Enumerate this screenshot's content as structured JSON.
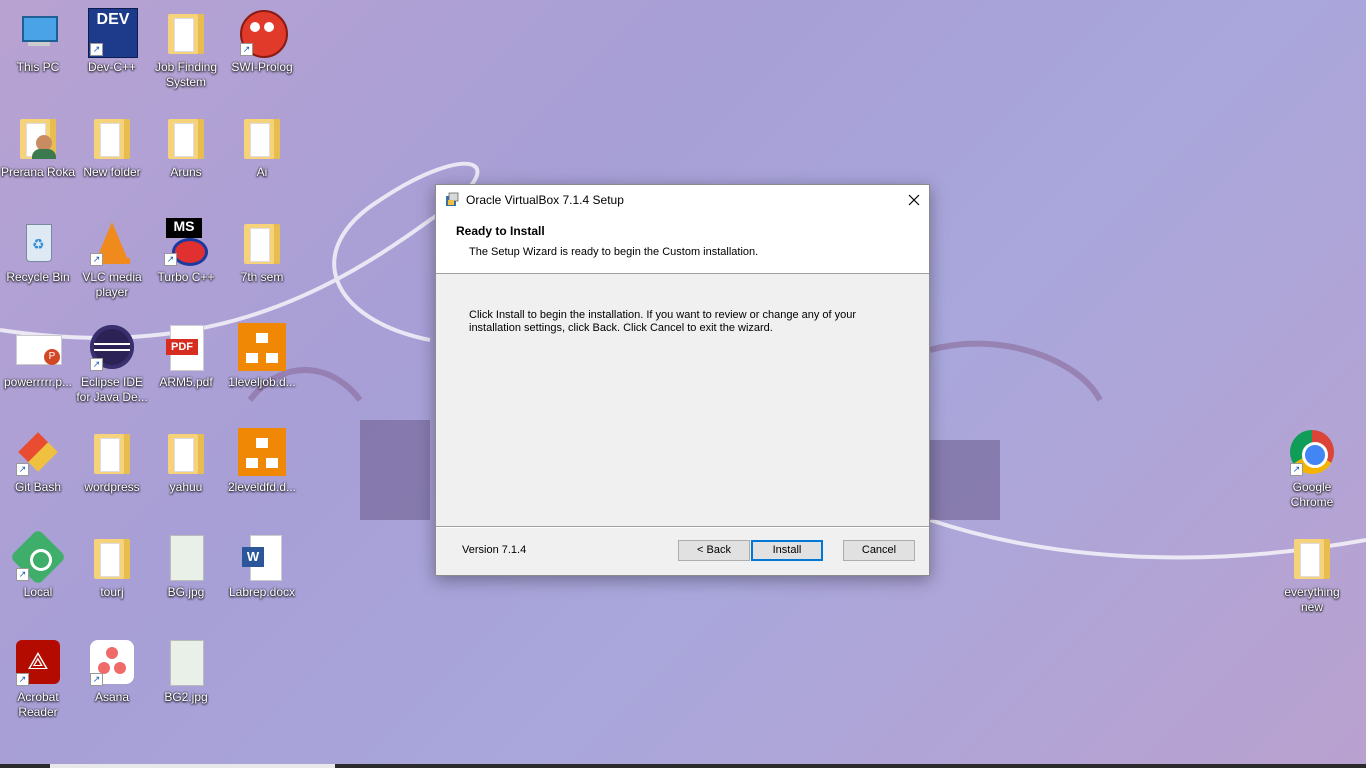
{
  "desktop": {
    "icons": [
      {
        "label": "This PC",
        "icon": "this-pc-icon",
        "shortcut": false
      },
      {
        "label": "Dev-C++",
        "icon": "dev-cpp-icon",
        "shortcut": true
      },
      {
        "label": "Job Finding System",
        "icon": "folder-icon",
        "shortcut": false
      },
      {
        "label": "SWI-Prolog",
        "icon": "swi-prolog-icon",
        "shortcut": true
      },
      {
        "label": "Prerana Roka",
        "icon": "user-folder-icon",
        "shortcut": false
      },
      {
        "label": "New folder",
        "icon": "folder-icon",
        "shortcut": false
      },
      {
        "label": "Aruns",
        "icon": "folder-icon",
        "shortcut": false
      },
      {
        "label": "Ai",
        "icon": "folder-icon",
        "shortcut": false
      },
      {
        "label": "Recycle Bin",
        "icon": "recycle-bin-icon",
        "shortcut": false
      },
      {
        "label": "VLC media player",
        "icon": "vlc-icon",
        "shortcut": true
      },
      {
        "label": "Turbo C++",
        "icon": "turbo-cpp-icon",
        "shortcut": true
      },
      {
        "label": "7th sem",
        "icon": "folder-icon",
        "shortcut": false
      },
      {
        "label": "powerrrrr.p...",
        "icon": "powerpoint-file-icon",
        "shortcut": false
      },
      {
        "label": "Eclipse IDE for Java De...",
        "icon": "eclipse-icon",
        "shortcut": true
      },
      {
        "label": "ARM5.pdf",
        "icon": "pdf-file-icon",
        "shortcut": false
      },
      {
        "label": "1leveljob.d...",
        "icon": "drawio-file-icon",
        "shortcut": false
      },
      {
        "label": "Git Bash",
        "icon": "git-bash-icon",
        "shortcut": true
      },
      {
        "label": "wordpress",
        "icon": "folder-icon",
        "shortcut": false
      },
      {
        "label": "yahuu",
        "icon": "folder-icon",
        "shortcut": false
      },
      {
        "label": "2leveldfd.d...",
        "icon": "drawio-file-icon",
        "shortcut": false
      },
      {
        "label": "Local",
        "icon": "local-icon",
        "shortcut": true
      },
      {
        "label": "tourj",
        "icon": "folder-icon",
        "shortcut": false
      },
      {
        "label": "BG.jpg",
        "icon": "image-file-icon",
        "shortcut": false
      },
      {
        "label": "Labrep.docx",
        "icon": "word-file-icon",
        "shortcut": false
      },
      {
        "label": "Acrobat Reader",
        "icon": "acrobat-icon",
        "shortcut": true
      },
      {
        "label": "Asana",
        "icon": "asana-icon",
        "shortcut": true
      },
      {
        "label": "BG2.jpg",
        "icon": "image-file-icon",
        "shortcut": false
      },
      {
        "label": "Google Chrome",
        "icon": "chrome-icon",
        "shortcut": true
      },
      {
        "label": "everything new",
        "icon": "folder-icon",
        "shortcut": false
      }
    ]
  },
  "dialog": {
    "title": "Oracle VirtualBox 7.1.4 Setup",
    "title_icon": "installer-icon",
    "close_icon": "close-icon",
    "heading": "Ready to Install",
    "subheading": "The Setup Wizard is ready to begin the Custom installation.",
    "body": "Click Install to begin the installation. If you want to review or change any of your installation settings, click Back. Click Cancel to exit the wizard.",
    "version": "Version 7.1.4",
    "back_label": "< Back",
    "install_label": "Install",
    "cancel_label": "Cancel"
  }
}
